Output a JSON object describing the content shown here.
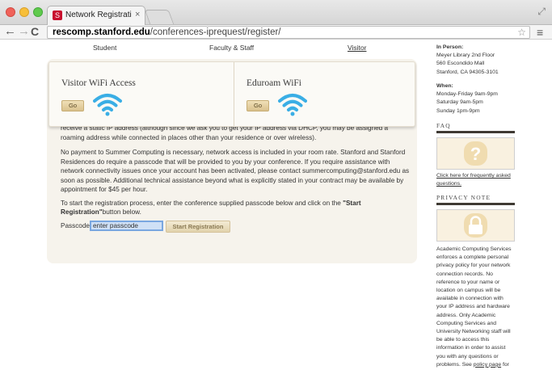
{
  "browser": {
    "tab_title": "Network Registration | Sta",
    "tab_close": "×",
    "favicon_glyph": "S",
    "url_host": "rescomp.stanford.edu",
    "url_path": "/conferences-iprequest/register/"
  },
  "subnav": {
    "student": "Student",
    "faculty_staff": "Faculty & Staff",
    "visitor": "Visitor"
  },
  "wifi": {
    "visitor_title": "Visitor WiFi Access",
    "eduroam_title": "Eduroam WiFi",
    "go_label": "Go",
    "icon_color": "#3aaee5"
  },
  "main": {
    "cut_paragraph": "receive a static IP address (although since we ask you to get your IP address via DHCP, you may be assigned a roaming address while connected in places other than your residence or over wireless).",
    "paragraph_2": "No payment to Summer Computing is necessary, network access is included in your room rate. Stanford and Stanford Residences do require a passcode that will be provided to you by your conference. If you require assistance with network connectivity issues once your account has been activated, please contact summercomputing@stanford.edu as soon as possible. Additional technical assistance beyond what is explicitly stated in your contract may be available by appointment for $45 per hour.",
    "paragraph_3_before": "To start the registration process, enter the conference supplied passcode below and click on the ",
    "paragraph_3_bold": "\"Start Registration\"",
    "paragraph_3_after": "button below.",
    "passcode_label": "Passcode:",
    "passcode_placeholder": "enter passcode",
    "start_button": "Start Registration"
  },
  "sidebar": {
    "in_person_head": "In Person:",
    "in_person_lines": [
      "Meyer Library 2nd Floor",
      "560 Escondido Mall",
      "Stanford, CA 94305-3101"
    ],
    "when_head": "When:",
    "when_lines": [
      "Monday-Friday 9am-9pm",
      "Saturday 9am-5pm",
      "Sunday 1pm-9pm"
    ],
    "faq_title": "FAQ",
    "faq_link": "Click here for frequently asked questions.",
    "privacy_title": "PRIVACY NOTE",
    "privacy_text": "Academic Computing Services enforces a complete personal privacy policy for your network connection records. No reference to your name or location on campus will be available in connection with your IP address and hardware address. Only Academic Computing Services and University Networking staff will be able to access this information in order to assist you with any questions or problems. See ",
    "privacy_link": "policy page",
    "privacy_tail": " for further details."
  },
  "colors": {
    "panel_bg": "#f6f3ec",
    "accent_tan": "#d9c18d",
    "sidebar_bar": "#3f3a33",
    "wifi_blue": "#3aaee5"
  }
}
